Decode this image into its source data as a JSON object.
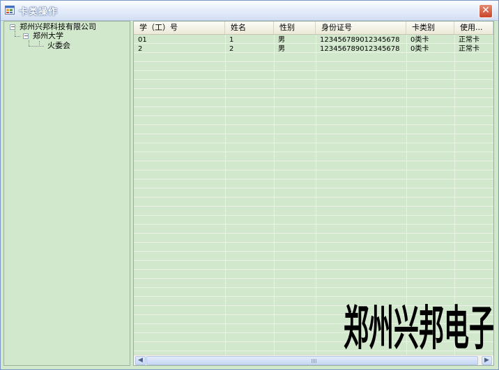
{
  "window": {
    "title": "卡类操作",
    "close_label": "✕"
  },
  "tree": {
    "root": "郑州兴邦科技有限公司",
    "child": "郑州大学",
    "grandchild": "火委会",
    "expander_symbol": "−"
  },
  "grid": {
    "columns": [
      "学（工）号",
      "姓名",
      "性别",
      "身份证号",
      "卡类别",
      "使用..."
    ],
    "rows": [
      [
        "01",
        "1",
        "男",
        "123456789012345678",
        "0类卡",
        "正常卡"
      ],
      [
        "2",
        "2",
        "男",
        "123456789012345678",
        "0类卡",
        "正常卡"
      ]
    ]
  },
  "scrollbar": {
    "left_arrow": "◀",
    "right_arrow": "▶"
  },
  "watermark": {
    "text": "郑州兴邦电子"
  },
  "colors": {
    "panel_bg": "#d2e8cc",
    "title_gradient_end": "#d3def3",
    "close_red": "#c9442a"
  }
}
